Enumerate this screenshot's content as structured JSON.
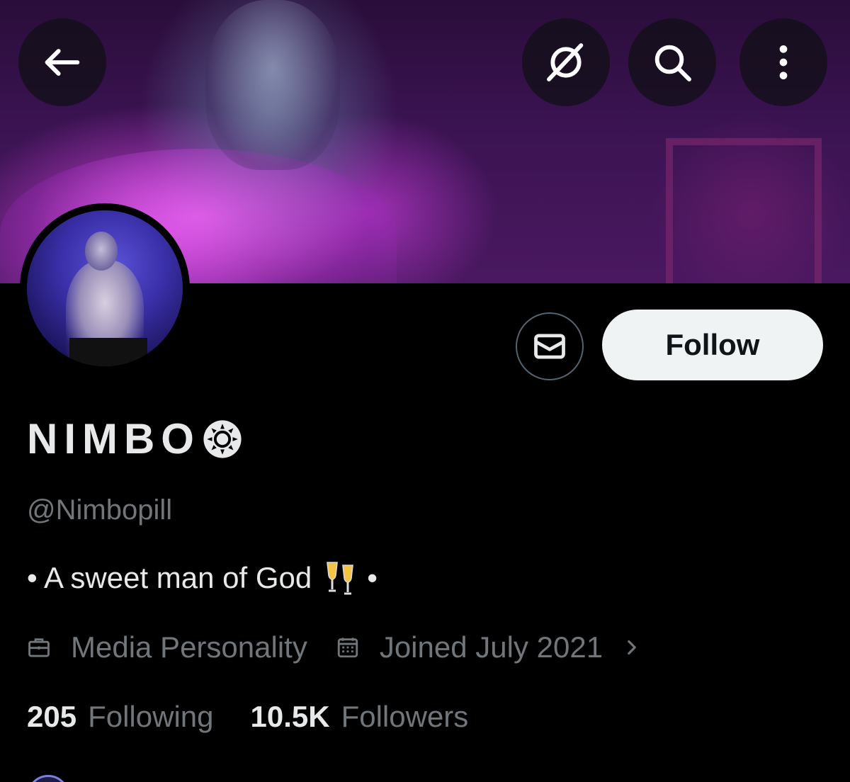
{
  "header": {
    "back_icon": "arrow-left-icon",
    "grok_icon": "grok-icon",
    "search_icon": "search-icon",
    "more_icon": "more-vertical-icon"
  },
  "profile": {
    "display_name": "NIMBO",
    "handle": "@Nimbopill",
    "bio_before": "• A sweet man of God",
    "bio_after": "•",
    "category": "Media Personality",
    "joined": "Joined July 2021",
    "following_count": "205",
    "following_label": "Following",
    "followers_count": "10.5K",
    "followers_label": "Followers"
  },
  "actions": {
    "follow_label": "Follow",
    "message_icon": "envelope-icon"
  },
  "colors": {
    "background": "#000000",
    "primary_text": "#e7e9ea",
    "secondary_text": "#71767b",
    "follow_bg": "#eff3f4",
    "banner_accent": "#c84ad8"
  }
}
